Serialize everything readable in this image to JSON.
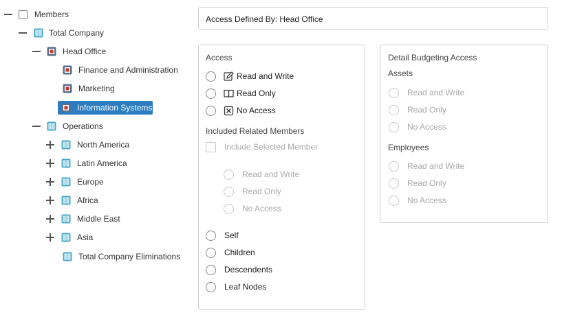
{
  "tree": {
    "root": {
      "label": "Members"
    },
    "total_company": {
      "label": "Total Company"
    },
    "head_office": {
      "label": "Head Office"
    },
    "head_office_children": [
      {
        "label": "Finance and Administration"
      },
      {
        "label": "Marketing"
      },
      {
        "label": "Information Systems",
        "selected": true
      }
    ],
    "operations": {
      "label": "Operations"
    },
    "operations_children": [
      {
        "label": "North America"
      },
      {
        "label": "Latin America"
      },
      {
        "label": "Europe"
      },
      {
        "label": "Africa"
      },
      {
        "label": "Middle East"
      },
      {
        "label": "Asia"
      },
      {
        "label": "Total Company Eliminations"
      }
    ]
  },
  "header": {
    "text": "Access Defined By: Head Office"
  },
  "access": {
    "title": "Access",
    "options": [
      {
        "label": "Read and Write",
        "icon": "pencil-icon"
      },
      {
        "label": "Read Only",
        "icon": "book-icon"
      },
      {
        "label": "No Access",
        "icon": "x-box-icon"
      }
    ],
    "related_title": "Included Related Members",
    "include_selected_label": "Include Selected Member",
    "sub_options": [
      {
        "label": "Read and Write"
      },
      {
        "label": "Read Only"
      },
      {
        "label": "No Access"
      }
    ],
    "relations": [
      {
        "label": "Self"
      },
      {
        "label": "Children"
      },
      {
        "label": "Descendents"
      },
      {
        "label": "Leaf Nodes"
      }
    ]
  },
  "detail": {
    "title": "Detail Budgeting Access",
    "assets_title": "Assets",
    "assets_options": [
      {
        "label": "Read and Write"
      },
      {
        "label": "Read Only"
      },
      {
        "label": "No Access"
      }
    ],
    "employees_title": "Employees",
    "employees_options": [
      {
        "label": "Read and Write"
      },
      {
        "label": "Read Only"
      },
      {
        "label": "No Access"
      }
    ]
  },
  "colors": {
    "selection": "#2b7cc0",
    "book_icon": "#3a9fc0",
    "head_office_icon": "#c0392b"
  }
}
